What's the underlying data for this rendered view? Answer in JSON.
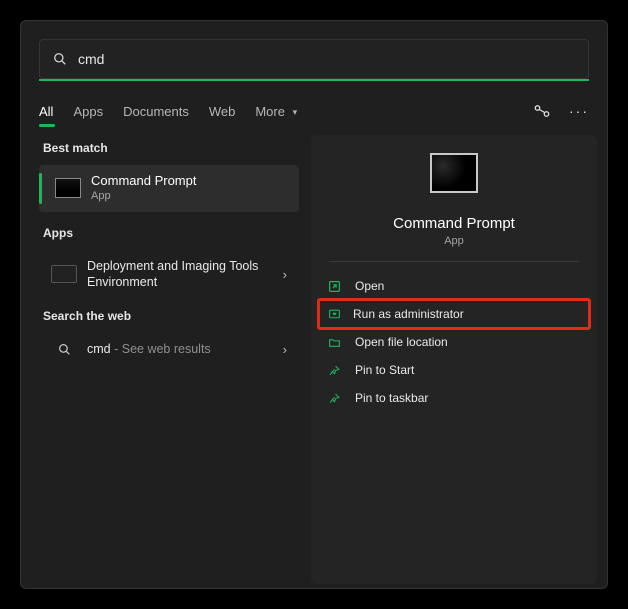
{
  "search": {
    "query": "cmd"
  },
  "tabs": {
    "all": "All",
    "apps": "Apps",
    "documents": "Documents",
    "web": "Web",
    "more": "More",
    "active": "all"
  },
  "sections": {
    "best_match": "Best match",
    "apps": "Apps",
    "search_web": "Search the web"
  },
  "best_match": {
    "title": "Command Prompt",
    "subtitle": "App"
  },
  "apps_list": [
    {
      "title_line1": "Deployment and Imaging Tools",
      "title_line2": "Environment"
    }
  ],
  "web_results": [
    {
      "query": "cmd",
      "suffix": " - See web results"
    }
  ],
  "preview": {
    "title": "Command Prompt",
    "subtitle": "App"
  },
  "actions": {
    "open": "Open",
    "run_admin": "Run as administrator",
    "open_location": "Open file location",
    "pin_start": "Pin to Start",
    "pin_taskbar": "Pin to taskbar"
  },
  "colors": {
    "accent": "#1db65a",
    "highlight_border": "#e22a18"
  }
}
